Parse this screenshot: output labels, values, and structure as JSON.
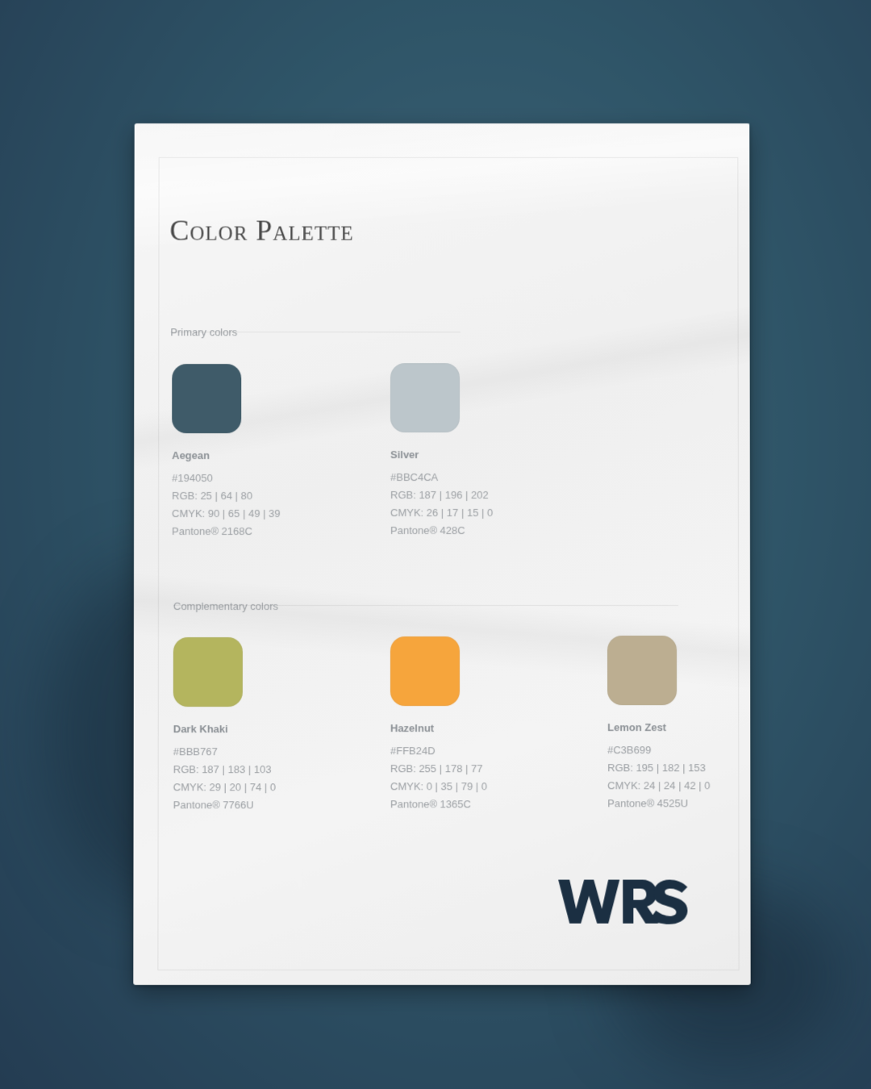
{
  "title": "Color Palette",
  "primary": {
    "label": "Primary colors",
    "swatches": [
      {
        "name": "Aegean",
        "hex": "#194050",
        "rgb": "RGB: 25 | 64 | 80",
        "cmyk": "CMYK: 90 | 65 | 49 | 39",
        "pantone": "Pantone® 2168C",
        "color": "#3f5b69"
      },
      {
        "name": "Silver",
        "hex": "#BBC4CA",
        "rgb": "RGB: 187 | 196 | 202",
        "cmyk": "CMYK: 26 | 17 | 15 | 0",
        "pantone": "Pantone® 428C",
        "color": "#bcc6cb"
      }
    ]
  },
  "complementary": {
    "label": "Complementary colors",
    "swatches": [
      {
        "name": "Dark Khaki",
        "hex": "#BBB767",
        "rgb": "RGB: 187 | 183 | 103",
        "cmyk": "CMYK: 29 | 20 | 74 | 0",
        "pantone": "Pantone® 7766U",
        "color": "#b4b55e"
      },
      {
        "name": "Hazelnut",
        "hex": "#FFB24D",
        "rgb": "RGB: 255 | 178 | 77",
        "cmyk": "CMYK: 0 | 35 | 79 | 0",
        "pantone": "Pantone® 1365C",
        "color": "#f6a53c"
      },
      {
        "name": "Lemon Zest",
        "hex": "#C3B699",
        "rgb": "RGB: 195 | 182 | 153",
        "cmyk": "CMYK: 24 | 24 | 42 | 0",
        "pantone": "Pantone® 4525U",
        "color": "#bcae91"
      }
    ]
  },
  "logo": {
    "text": "WRS",
    "color": "#1b2f42"
  }
}
